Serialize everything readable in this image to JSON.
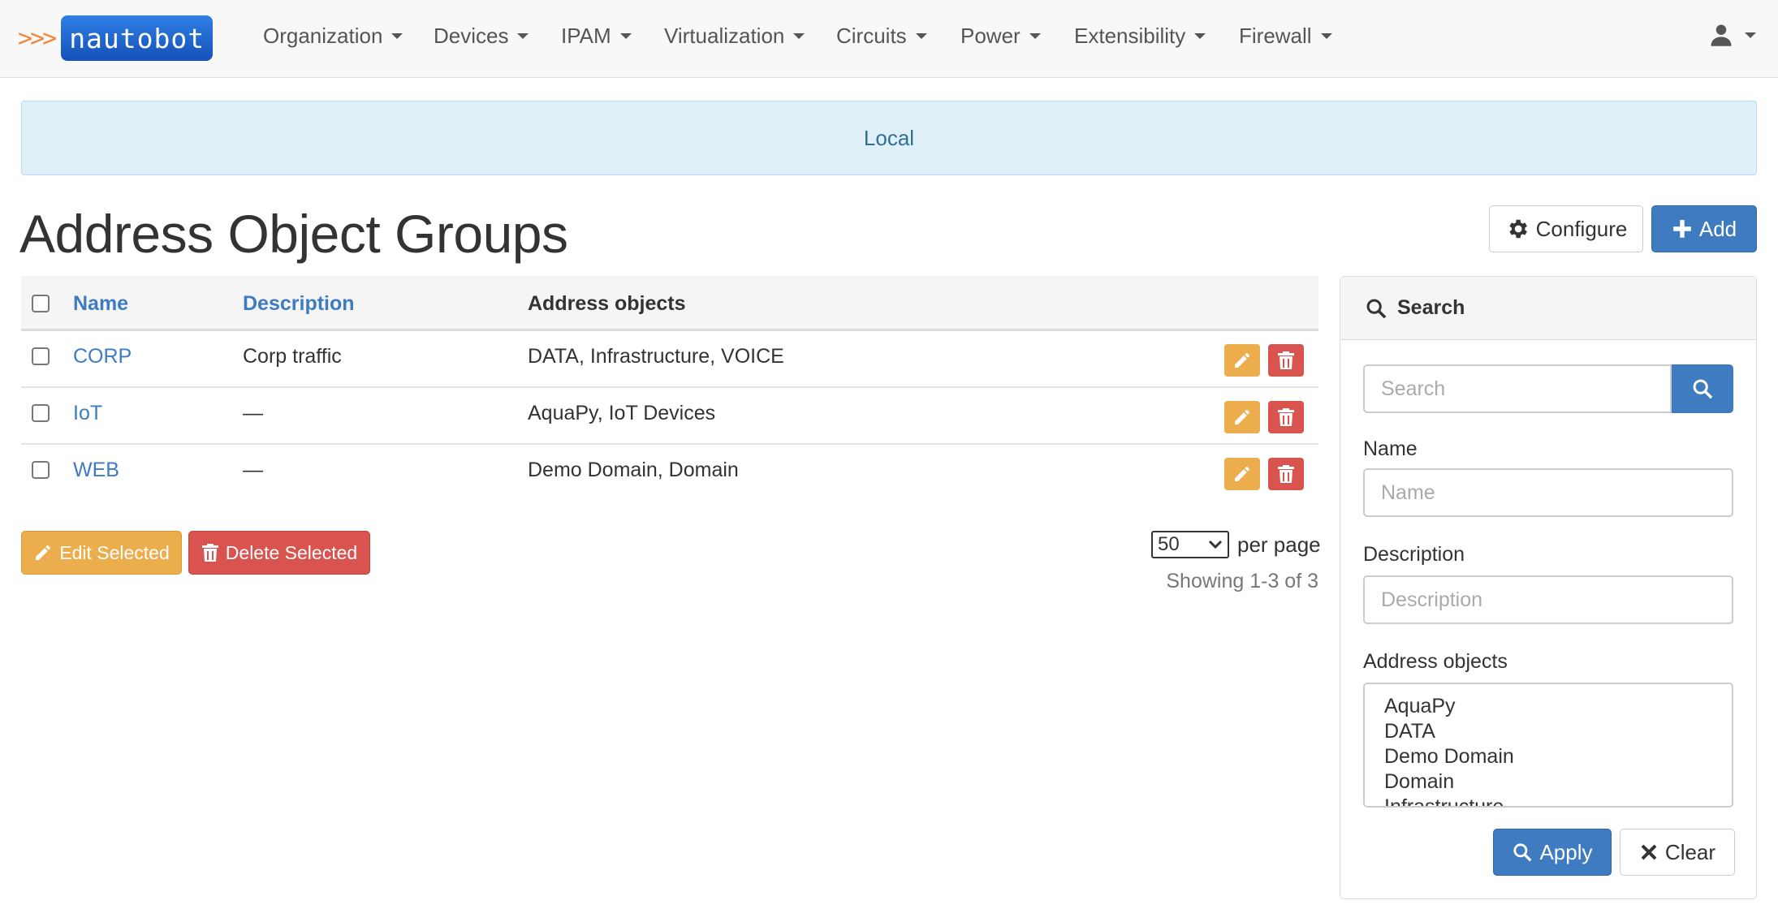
{
  "brand": {
    "arrows": ">>>",
    "name": "nautobot"
  },
  "nav": [
    {
      "label": "Organization"
    },
    {
      "label": "Devices"
    },
    {
      "label": "IPAM"
    },
    {
      "label": "Virtualization"
    },
    {
      "label": "Circuits"
    },
    {
      "label": "Power"
    },
    {
      "label": "Extensibility"
    },
    {
      "label": "Firewall"
    }
  ],
  "banner": {
    "text": "Local"
  },
  "page": {
    "title": "Address Object Groups"
  },
  "actions": {
    "configure": "Configure",
    "add": "Add"
  },
  "table": {
    "headers": {
      "name": "Name",
      "description": "Description",
      "address_objects": "Address objects"
    },
    "rows": [
      {
        "name": "CORP",
        "description": "Corp traffic",
        "address_objects": "DATA, Infrastructure, VOICE"
      },
      {
        "name": "IoT",
        "description": "—",
        "address_objects": "AquaPy, IoT Devices"
      },
      {
        "name": "WEB",
        "description": "—",
        "address_objects": "Demo Domain, Domain"
      }
    ]
  },
  "bulk": {
    "edit": "Edit Selected",
    "delete": "Delete Selected"
  },
  "pagination": {
    "per_page_value": "50",
    "per_page_label": "per page",
    "showing": "Showing 1-3 of 3"
  },
  "search_panel": {
    "title": "Search",
    "search_placeholder": "Search",
    "name_label": "Name",
    "name_placeholder": "Name",
    "description_label": "Description",
    "description_placeholder": "Description",
    "address_objects_label": "Address objects",
    "address_objects_options": [
      "AquaPy",
      "DATA",
      "Demo Domain",
      "Domain",
      "Infrastructure"
    ],
    "apply": "Apply",
    "clear": "Clear"
  },
  "colors": {
    "primary": "#3e7bc0",
    "warning": "#ecad4d",
    "danger": "#d9534f",
    "info_bg": "#dff0f8",
    "brand_orange": "#f0883b"
  }
}
